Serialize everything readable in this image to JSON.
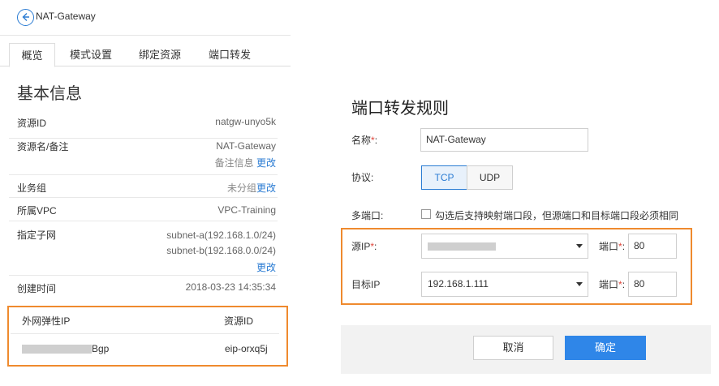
{
  "header": {
    "title": "NAT-Gateway",
    "back_icon": "back-arrow-icon"
  },
  "tabs": [
    {
      "label": "概览",
      "active": true
    },
    {
      "label": "模式设置",
      "active": false
    },
    {
      "label": "绑定资源",
      "active": false
    },
    {
      "label": "端口转发",
      "active": false
    }
  ],
  "basic_info": {
    "title": "基本信息",
    "resource_id": {
      "label": "资源ID",
      "value": "natgw-unyo5k"
    },
    "name_note": {
      "label": "资源名/备注",
      "value": "NAT-Gateway",
      "note": "备注信息",
      "edit": "更改"
    },
    "business_group": {
      "label": "业务组",
      "value": "未分组",
      "edit": "更改"
    },
    "vpc": {
      "label": "所属VPC",
      "value": "VPC-Training"
    },
    "subnet": {
      "label": "指定子网",
      "values": [
        "subnet-a(192.168.1.0/24)",
        "subnet-b(192.168.0.0/24)"
      ],
      "edit": "更改"
    },
    "created": {
      "label": "创建时间",
      "value": "2018-03-23 14:35:34"
    }
  },
  "eip_table": {
    "col1": "外网弹性IP",
    "col2": "资源ID",
    "row": {
      "ip_suffix": "Bgp",
      "resource_id": "eip-orxq5j"
    }
  },
  "port_forward": {
    "title": "端口转发规则",
    "name_label": "名称",
    "name_value": "NAT-Gateway",
    "protocol_label": "协议:",
    "protocol_tcp": "TCP",
    "protocol_udp": "UDP",
    "protocol_selected": "TCP",
    "multi_port_label": "多端口:",
    "multi_port_text": "勾选后支持映射端口段，但源端口和目标端口段必须相同",
    "multi_port_checked": false,
    "src_ip_label": "源IP",
    "src_port_label": "端口",
    "src_port_value": "80",
    "dst_ip_label": "目标IP",
    "dst_ip_value": "192.168.1.111",
    "dst_port_label": "端口",
    "dst_port_value": "80",
    "cancel": "取消",
    "ok": "确定"
  },
  "colors": {
    "accent": "#2b7cd3",
    "highlight_border": "#ef8a2e",
    "primary_button": "#2f86e8",
    "required": "#e0463b"
  }
}
